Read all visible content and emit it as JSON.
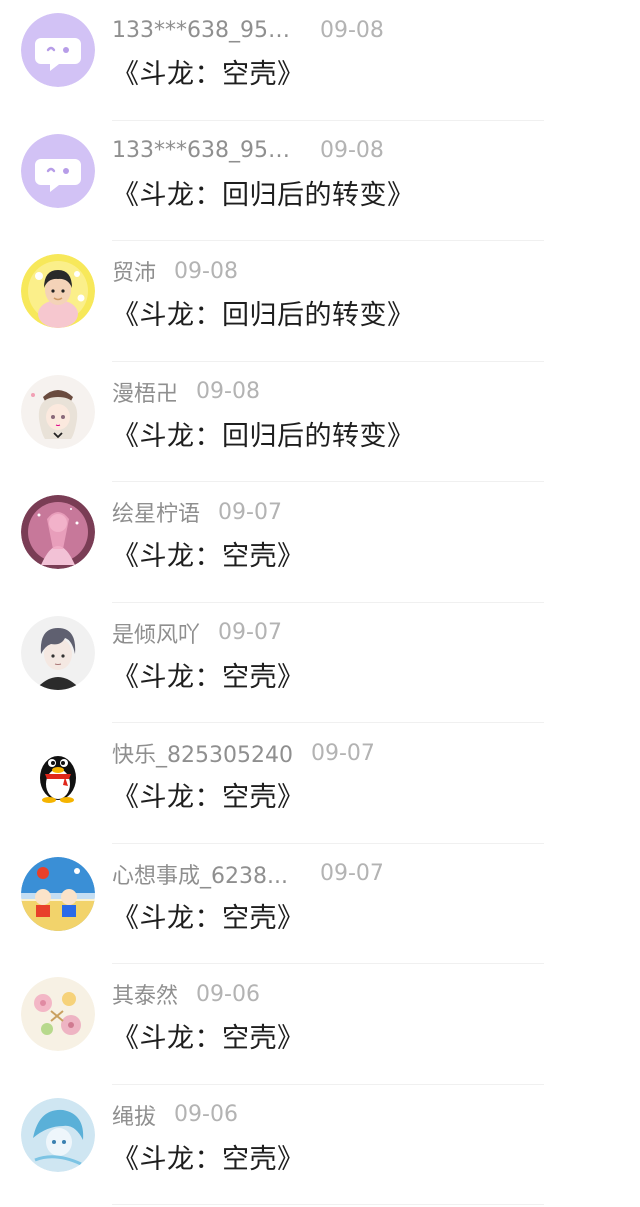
{
  "comments": [
    {
      "username": "133***638_950...",
      "date": "09-08",
      "title": "《斗龙：空壳》",
      "avatar": "purple-chat-bubble-icon"
    },
    {
      "username": "133***638_950...",
      "date": "09-08",
      "title": "《斗龙：回归后的转变》",
      "avatar": "purple-chat-bubble-icon"
    },
    {
      "username": "贸沛",
      "date": "09-08",
      "title": "《斗龙：回归后的转变》",
      "avatar": "user-photo-avatar"
    },
    {
      "username": "漫梧卍",
      "date": "09-08",
      "title": "《斗龙：回归后的转变》",
      "avatar": "anime-girl-avatar"
    },
    {
      "username": "绘星柠语",
      "date": "09-07",
      "title": "《斗龙：空壳》",
      "avatar": "pink-anime-avatar"
    },
    {
      "username": "是倾风吖",
      "date": "09-07",
      "title": "《斗龙：空壳》",
      "avatar": "anime-boy-avatar"
    },
    {
      "username": "快乐_825305240",
      "date": "09-07",
      "title": "《斗龙：空壳》",
      "avatar": "qq-penguin-avatar"
    },
    {
      "username": "心想事成_6238...",
      "date": "09-07",
      "title": "《斗龙：空壳》",
      "avatar": "beach-cartoon-avatar"
    },
    {
      "username": "其泰然",
      "date": "09-06",
      "title": "《斗龙：空壳》",
      "avatar": "flowers-avatar"
    },
    {
      "username": "绳拔",
      "date": "09-06",
      "title": "《斗龙：空壳》",
      "avatar": "blue-anime-avatar"
    }
  ]
}
